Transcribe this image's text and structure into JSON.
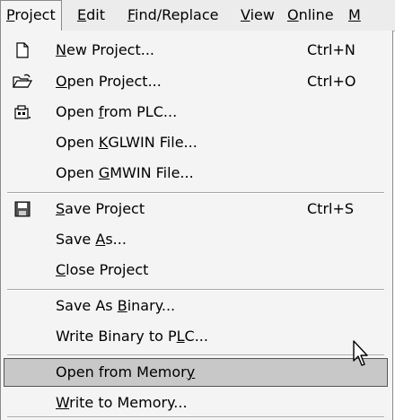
{
  "menubar": {
    "items": [
      {
        "pre": "",
        "u": "P",
        "post": "roject",
        "active": true
      },
      {
        "pre": "",
        "u": "E",
        "post": "dit"
      },
      {
        "pre": "",
        "u": "F",
        "post": "ind/Replace"
      },
      {
        "pre": "",
        "u": "V",
        "post": "iew"
      },
      {
        "pre": "",
        "u": "O",
        "post": "nline"
      },
      {
        "pre": "",
        "u": "M",
        "post": ""
      }
    ]
  },
  "menu": {
    "new_project": {
      "pre": "",
      "u": "N",
      "post": "ew Project...",
      "shortcut": "Ctrl+N"
    },
    "open_project": {
      "pre": "",
      "u": "O",
      "post": "pen Project...",
      "shortcut": "Ctrl+O"
    },
    "open_from_plc": {
      "pre": "Open ",
      "u": "f",
      "post": "rom PLC..."
    },
    "open_kglwin": {
      "pre": "Open ",
      "u": "K",
      "post": "GLWIN File..."
    },
    "open_gmwin": {
      "pre": "Open ",
      "u": "G",
      "post": "MWIN File..."
    },
    "save_project": {
      "pre": "",
      "u": "S",
      "post": "ave Project",
      "shortcut": "Ctrl+S"
    },
    "save_as": {
      "pre": "Save ",
      "u": "A",
      "post": "s..."
    },
    "close_project": {
      "pre": "",
      "u": "C",
      "post": "lose Project"
    },
    "save_as_binary": {
      "pre": "Save As ",
      "u": "B",
      "post": "inary..."
    },
    "write_binary": {
      "pre": "Write Binary to P",
      "u": "L",
      "post": "C..."
    },
    "open_from_memory": {
      "pre": "Open from Memor",
      "u": "y",
      "post": ""
    },
    "write_to_memory": {
      "pre": "",
      "u": "W",
      "post": "rite to Memory..."
    }
  }
}
